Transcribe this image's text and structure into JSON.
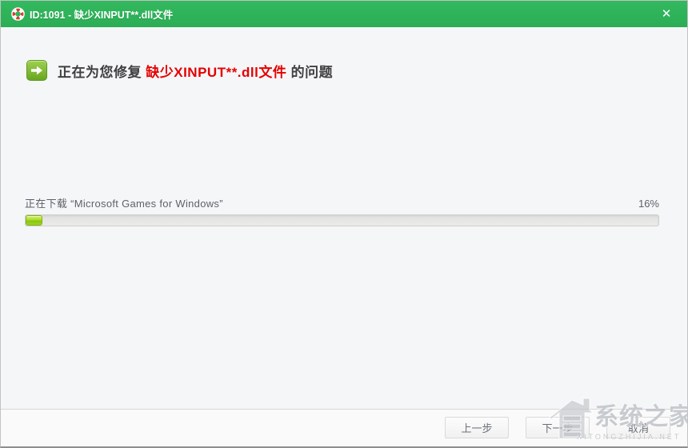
{
  "window": {
    "title": "ID:1091 - 缺少XINPUT**.dll文件",
    "close_glyph": "✕"
  },
  "header": {
    "prefix": "正在为您修复 ",
    "highlight": "缺少XINPUT**.dll文件",
    "suffix": " 的问题"
  },
  "download": {
    "status_text": "正在下载 “Microsoft Games for Windows”",
    "percent_label": "16%",
    "percent_value": 16,
    "bar_fill_percent": 2.7
  },
  "footer": {
    "buttons": [
      {
        "label": "上一步"
      },
      {
        "label": "下一步"
      },
      {
        "label": "取消"
      }
    ]
  },
  "watermark": {
    "title": "系统之家",
    "subtitle": "XITONGZHIJIA.NET"
  },
  "colors": {
    "titlebar_green": "#2fb45c",
    "accent_red": "#e60000",
    "progress_fill_green": "#8bc412"
  }
}
